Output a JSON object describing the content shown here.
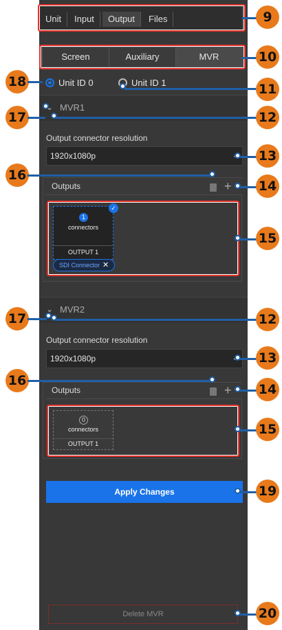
{
  "top_tabs": [
    "Unit",
    "Input",
    "Output",
    "Files"
  ],
  "sub_tabs": [
    "Screen",
    "Auxiliary",
    "MVR"
  ],
  "unit_ids": [
    "Unit ID 0",
    "Unit ID 1"
  ],
  "mvr1": {
    "title": "MVR1",
    "resolution_label": "Output connector resolution",
    "resolution_value": "1920x1080p",
    "outputs_label": "Outputs",
    "connector_count": "1",
    "connector_text": "connectors",
    "output_name": "OUTPUT 1",
    "chip": "SDI Connector"
  },
  "mvr2": {
    "title": "MVR2",
    "resolution_label": "Output connector resolution",
    "resolution_value": "1920x1080p",
    "outputs_label": "Outputs",
    "connector_count": "0",
    "connector_text": "connectors",
    "output_name": "OUTPUT 1"
  },
  "apply_label": "Apply Changes",
  "delete_label": "Delete MVR",
  "callouts": [
    "9",
    "10",
    "18",
    "11",
    "17",
    "12",
    "13",
    "16",
    "14",
    "15",
    "17",
    "12",
    "13",
    "16",
    "14",
    "15",
    "19",
    "20"
  ]
}
